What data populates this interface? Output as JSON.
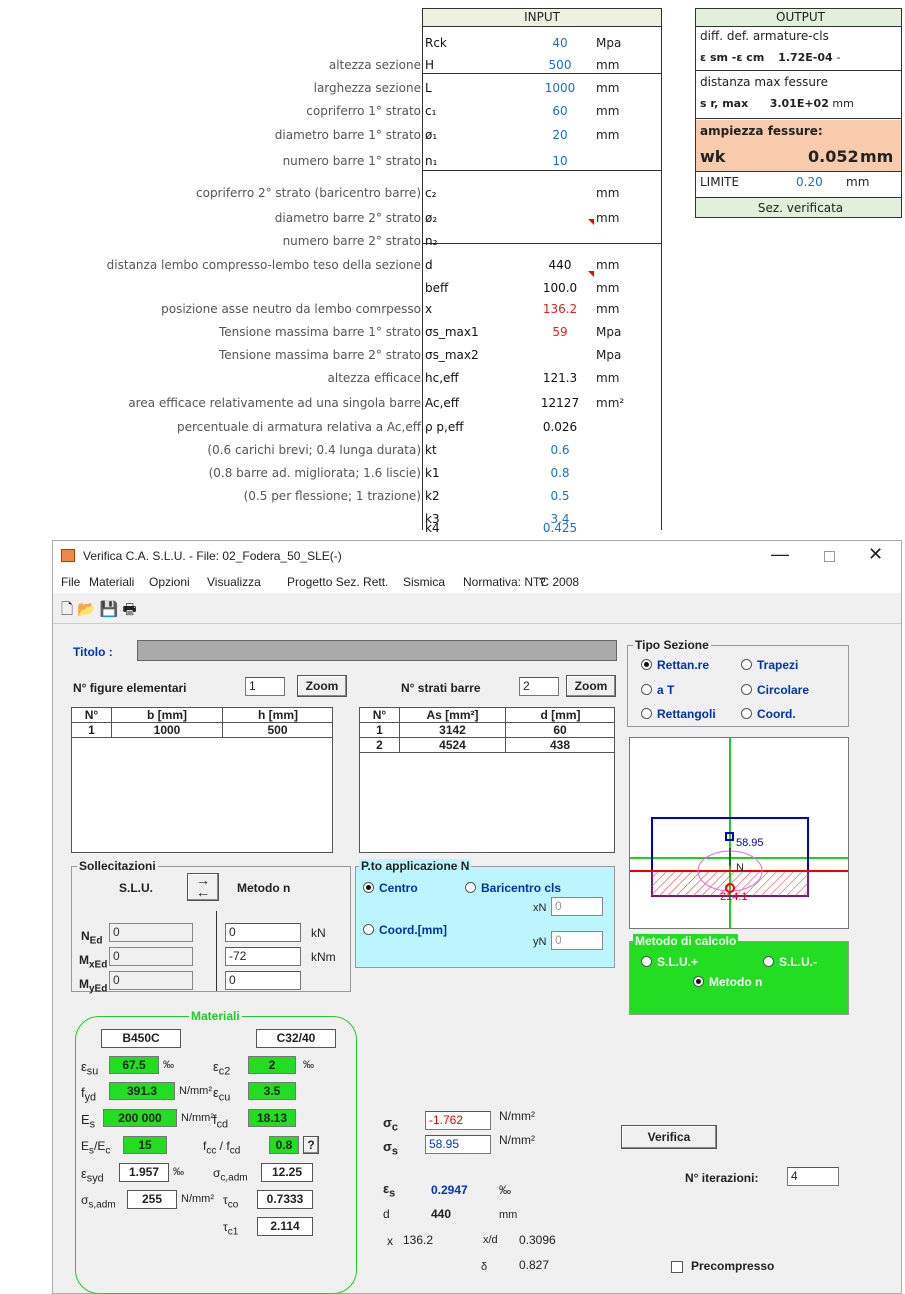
{
  "sheet": {
    "input_header": "INPUT",
    "rows": [
      {
        "label": "",
        "symbol": "Rck",
        "value": "40",
        "unit": "Mpa",
        "color": "blue"
      },
      {
        "label": "altezza sezione",
        "symbol": "H",
        "value": "500",
        "unit": "mm",
        "color": "blue"
      },
      {
        "label": "larghezza sezione",
        "symbol": "L",
        "value": "1000",
        "unit": "mm",
        "color": "blue"
      },
      {
        "label": "copriferro 1° strato",
        "symbol": "c₁",
        "value": "60",
        "unit": "mm",
        "color": "blue"
      },
      {
        "label": "diametro barre 1° strato",
        "symbol": "ø₁",
        "value": "20",
        "unit": "mm",
        "color": "blue"
      },
      {
        "label": "numero barre 1° strato",
        "symbol": "n₁",
        "value": "10",
        "unit": "",
        "color": "blue"
      },
      {
        "label": "copriferro 2° strato (baricentro barre)",
        "symbol": "c₂",
        "value": "",
        "unit": "mm",
        "color": "blue"
      },
      {
        "label": "diametro barre 2° strato",
        "symbol": "ø₂",
        "value": "",
        "unit": "mm",
        "color": "blue"
      },
      {
        "label": "numero barre 2° strato",
        "symbol": "n₂",
        "value": "",
        "unit": "",
        "color": "blue"
      },
      {
        "label": "distanza lembo compresso-lembo teso della sezione",
        "symbol": "d",
        "value": "440",
        "unit": "mm",
        "color": "black"
      },
      {
        "label": "",
        "symbol": "beff",
        "value": "100.0",
        "unit": "mm",
        "color": "black"
      },
      {
        "label": "posizione asse neutro da lembo comrpesso",
        "symbol": "x",
        "value": "136.2",
        "unit": "mm",
        "color": "red"
      },
      {
        "label": "Tensione massima barre 1° strato",
        "symbol": "σs_max1",
        "value": "59",
        "unit": "Mpa",
        "color": "red"
      },
      {
        "label": "Tensione massima barre 2° strato",
        "symbol": "σs_max2",
        "value": "",
        "unit": "Mpa",
        "color": "red"
      },
      {
        "label": "altezza efficace",
        "symbol": "hc,eff",
        "value": "121.3",
        "unit": "mm",
        "color": "black"
      },
      {
        "label": "area efficace relativamente ad una singola barre",
        "symbol": "Ac,eff",
        "value": "12127",
        "unit": "mm²",
        "color": "black"
      },
      {
        "label": "percentuale di armatura relativa a Ac,eff",
        "symbol": "ρ p,eff",
        "value": "0.026",
        "unit": "",
        "color": "black"
      },
      {
        "label": "(0.6 carichi brevi; 0.4 lunga durata)",
        "symbol": "kt",
        "value": "0.6",
        "unit": "",
        "color": "blue"
      },
      {
        "label": "(0.8 barre ad. migliorata; 1.6 liscie)",
        "symbol": "k1",
        "value": "0.8",
        "unit": "",
        "color": "blue"
      },
      {
        "label": "(0.5 per flessione; 1 trazione)",
        "symbol": "k2",
        "value": "0.5",
        "unit": "",
        "color": "blue"
      },
      {
        "label": "",
        "symbol": "k3",
        "value": "3.4",
        "unit": "",
        "color": "blue"
      },
      {
        "label": "",
        "symbol": "k4",
        "value": "0.425",
        "unit": "",
        "color": "blue"
      }
    ],
    "output": {
      "header": "OUTPUT",
      "diff_label": "diff. def. armature-cls",
      "eps_label": "ε sm -ε cm",
      "eps_value": "1.72E-04",
      "eps_unit": "-",
      "dist_label": "distanza max fessure",
      "sr_label": "s r, max",
      "sr_value": "3.01E+02",
      "sr_unit": "mm",
      "amp_label": "ampiezza fessure:",
      "wk_label": "wk",
      "wk_value": "0.052",
      "wk_unit": "mm",
      "limit_label": "LIMITE",
      "limit_value": "0.20",
      "limit_unit": "mm",
      "status": "Sez. verificata",
      "accent_color": "#f8cbad",
      "header_color": "#e2efda"
    }
  },
  "app": {
    "title": "Verifica C.A. S.L.U. - File: 02_Fodera_50_SLE(-)",
    "menu": [
      "File",
      "Materiali",
      "Opzioni",
      "Visualizza",
      "Progetto Sez. Rett.",
      "Sismica",
      "Normativa: NTC 2008",
      "?"
    ],
    "titolo_label": "Titolo :",
    "n_figure_label": "N° figure elementari",
    "n_figure_value": "1",
    "zoom_label": "Zoom",
    "n_strati_label": "N° strati barre",
    "n_strati_value": "2",
    "fig_table": {
      "headers": [
        "N°",
        "b [mm]",
        "h [mm]"
      ],
      "rows": [
        [
          "1",
          "1000",
          "500"
        ]
      ]
    },
    "bar_table": {
      "headers": [
        "N°",
        "As [mm²]",
        "d [mm]"
      ],
      "rows": [
        [
          "1",
          "3142",
          "60"
        ],
        [
          "2",
          "4524",
          "438"
        ]
      ]
    },
    "tipo_sezione": {
      "title": "Tipo Sezione",
      "options": [
        "Rettan.re",
        "Trapezi",
        "a T",
        "Circolare",
        "Rettangoli",
        "Coord."
      ],
      "selected": "Rettan.re"
    },
    "preview": {
      "top_label": "58.95",
      "neutral_label": "N",
      "bottom_label": "214.1"
    },
    "sollecitazioni": {
      "title": "Sollecitazioni",
      "slu": "S.L.U.",
      "metodo": "Metodo n",
      "ned": "0",
      "mxed": "0",
      "myed": "0",
      "ned2": "0",
      "mxed2": "-72",
      "myed2": "0",
      "unit_kn": "kN",
      "unit_knm": "kNm"
    },
    "applicazione": {
      "title": "P.to applicazione N",
      "centro": "Centro",
      "baricentro": "Baricentro cls",
      "coord": "Coord.[mm]",
      "xn": "0",
      "yn": "0",
      "xn_label": "xN",
      "yn_label": "yN"
    },
    "metodo_calcolo": {
      "title": "Metodo di calcolo",
      "slu_plus": "S.L.U.+",
      "slu_minus": "S.L.U.-",
      "metodo_n": "Metodo n",
      "color": "#22dd22"
    },
    "materiali": {
      "title": "Materiali",
      "steel": "B450C",
      "concrete": "C32/40",
      "esu": "67.5",
      "ec2": "2",
      "fyd": "391.3",
      "ecu": "3.5",
      "es": "200 000",
      "fcd": "18.13",
      "es_ec": "15",
      "fcc_fcd": "0.8",
      "esyd": "1.957",
      "sc_adm": "12.25",
      "ss_adm": "255",
      "tco": "0.7333",
      "tc1": "2.114",
      "permille": "‰",
      "nmm2": "N/mm²",
      "q": "?"
    },
    "results": {
      "sc": "-1.762",
      "ss": "58.95",
      "unit": "N/mm²",
      "es": "0.2947",
      "es_unit": "‰",
      "d": "440",
      "d_unit": "mm",
      "x": "136.2",
      "xd": "0.3096",
      "delta": "0.827"
    },
    "verifica_label": "Verifica",
    "iterazioni_label": "N° iterazioni:",
    "iterazioni_value": "4",
    "precompresso_label": "Precompresso"
  }
}
